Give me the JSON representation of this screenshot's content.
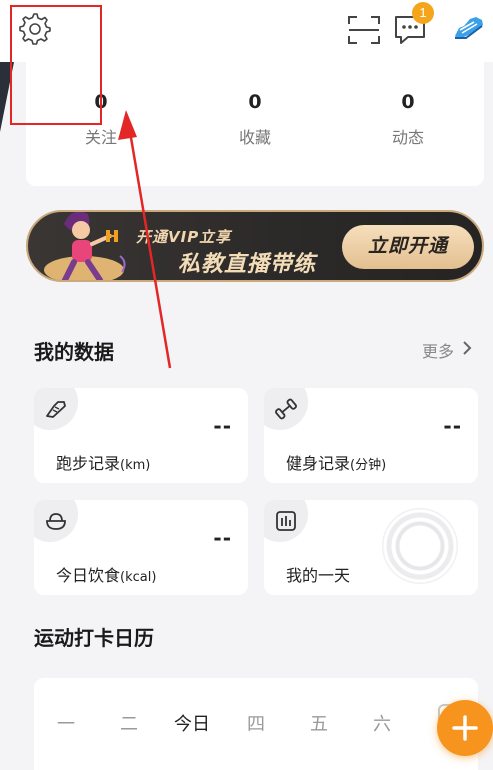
{
  "topbar": {
    "icons": [
      "gear-icon",
      "scan-icon",
      "message-icon",
      "sneaker-icon"
    ],
    "message_badge": "1"
  },
  "stats": [
    {
      "value": "0",
      "label": "关注"
    },
    {
      "value": "0",
      "label": "收藏"
    },
    {
      "value": "0",
      "label": "动态"
    }
  ],
  "vip_banner": {
    "line1": "开通VIP立享",
    "line2": "私教直播带练",
    "button": "立即开通"
  },
  "my_data": {
    "title": "我的数据",
    "more": "更多",
    "cards": [
      {
        "icon": "sneaker-icon",
        "label": "跑步记录",
        "unit": "(km)",
        "value": "--"
      },
      {
        "icon": "dumbbell-icon",
        "label": "健身记录",
        "unit": "(分钟)",
        "value": "--"
      },
      {
        "icon": "bowl-icon",
        "label": "今日饮食",
        "unit": "(kcal)",
        "value": "--"
      },
      {
        "icon": "bar-chart-icon",
        "label": "我的一天"
      }
    ]
  },
  "calendar": {
    "title": "运动打卡日历",
    "days": [
      "一",
      "二",
      "今日",
      "四",
      "五",
      "六"
    ]
  },
  "colors": {
    "accent_orange": "#f7941d",
    "badge": "#f5a51c",
    "vip_gold": "#e3bf90",
    "annotation_red": "#e32626"
  }
}
